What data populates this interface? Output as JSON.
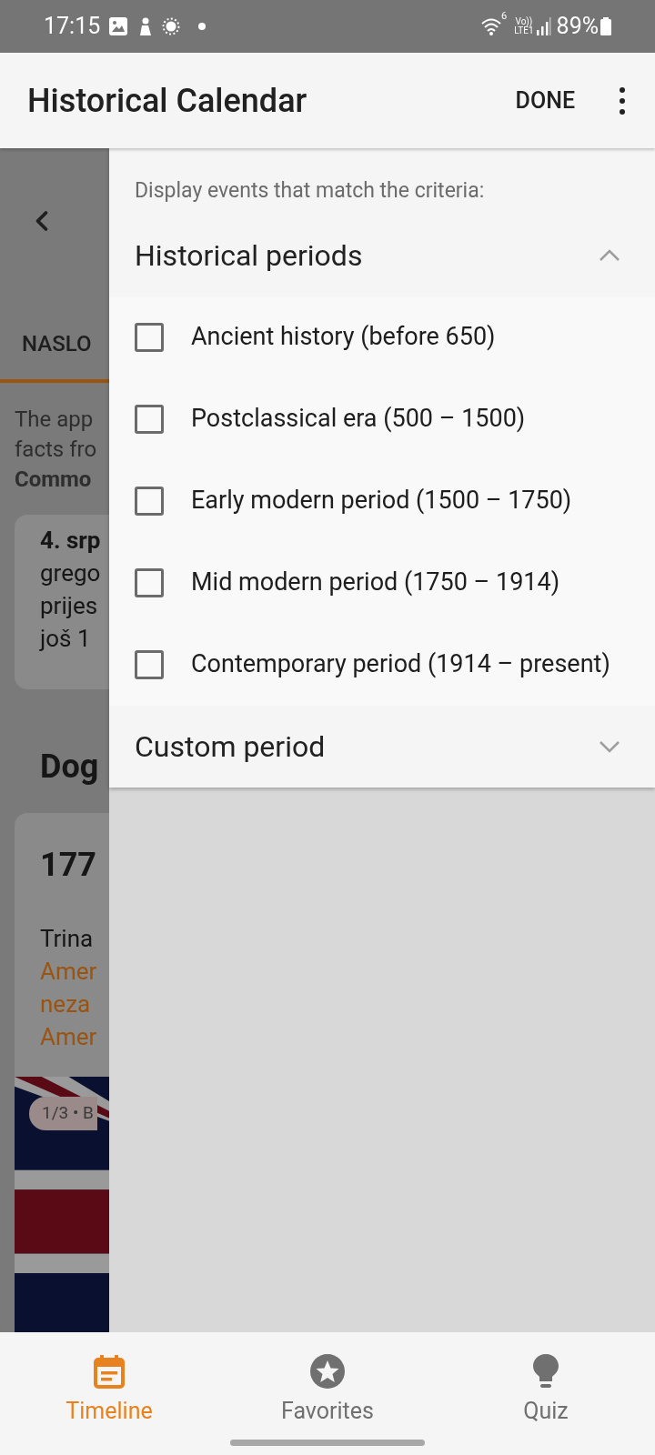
{
  "status_bar": {
    "time": "17:15",
    "wifi_label": "6",
    "volte_label": "Vo))",
    "network_label": "LTE1",
    "battery": "89%"
  },
  "app_bar": {
    "title": "Historical Calendar",
    "done": "DONE"
  },
  "background_screen": {
    "tab": "NASLO",
    "notice": [
      "The app",
      "facts fro"
    ],
    "notice_bold": "Commo",
    "today_card": {
      "title": "4. srp",
      "lines": [
        "grego",
        "prijes",
        "još 1"
      ]
    },
    "heading": "Dog",
    "event_card": {
      "year": "177",
      "text": "Trina",
      "links": [
        "Amer",
        "neza",
        "Amer"
      ],
      "image": {
        "kind": "picture",
        "counter": "1/3 • B"
      }
    }
  },
  "filter_panel": {
    "subtitle": "Display events that match the criteria:",
    "sections": [
      {
        "title": "Historical periods",
        "expanded": true,
        "options": [
          {
            "label": "Ancient history (before 650)",
            "checked": false
          },
          {
            "label": "Postclassical era (500 – 1500)",
            "checked": false
          },
          {
            "label": "Early modern period (1500 – 1750)",
            "checked": false
          },
          {
            "label": "Mid modern period (1750 – 1914)",
            "checked": false
          },
          {
            "label": "Contemporary period (1914 – present)",
            "checked": false
          }
        ]
      },
      {
        "title": "Custom period",
        "expanded": false
      }
    ]
  },
  "bottom_nav": [
    {
      "kind": "calendar",
      "label": "Timeline",
      "selected": true
    },
    {
      "kind": "star",
      "label": "Favorites",
      "selected": false
    },
    {
      "kind": "bulb",
      "label": "Quiz",
      "selected": false
    }
  ]
}
